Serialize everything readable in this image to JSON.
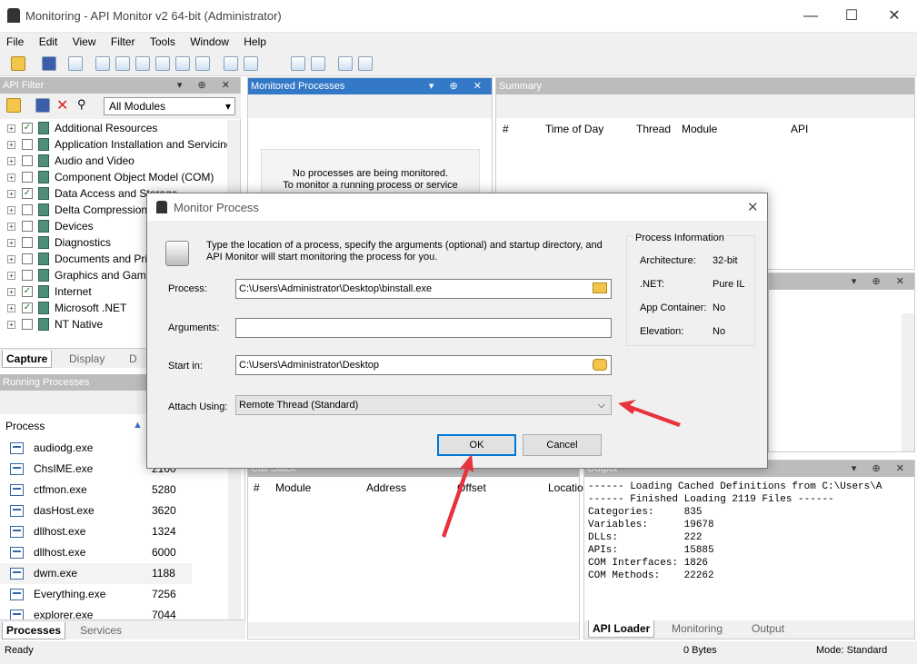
{
  "window": {
    "title": "Monitoring - API Monitor v2 64-bit (Administrator)",
    "min": "—",
    "max": "☐",
    "close": "✕"
  },
  "menu": [
    "File",
    "Edit",
    "View",
    "Filter",
    "Tools",
    "Window",
    "Help"
  ],
  "api_filter": {
    "title": "API Filter",
    "module_select": "All Modules",
    "items": [
      {
        "label": "Additional Resources",
        "checked": true
      },
      {
        "label": "Application Installation and Servicing",
        "checked": false
      },
      {
        "label": "Audio and Video",
        "checked": false
      },
      {
        "label": "Component Object Model (COM)",
        "checked": false
      },
      {
        "label": "Data Access and Storage",
        "checked": true
      },
      {
        "label": "Delta Compression",
        "checked": false
      },
      {
        "label": "Devices",
        "checked": false
      },
      {
        "label": "Diagnostics",
        "checked": false
      },
      {
        "label": "Documents and Printing",
        "checked": false
      },
      {
        "label": "Graphics and Gaming",
        "checked": false
      },
      {
        "label": "Internet",
        "checked": true
      },
      {
        "label": "Microsoft .NET",
        "checked": true
      },
      {
        "label": "NT Native",
        "checked": false
      }
    ],
    "tabs": [
      "Capture",
      "Display",
      "D"
    ]
  },
  "running_processes": {
    "title": "Running Processes",
    "col_process": "Process",
    "rows": [
      {
        "name": "audiodg.exe",
        "pid": ""
      },
      {
        "name": "ChsIME.exe",
        "pid": "2100"
      },
      {
        "name": "ctfmon.exe",
        "pid": "5280"
      },
      {
        "name": "dasHost.exe",
        "pid": "3620"
      },
      {
        "name": "dllhost.exe",
        "pid": "1324"
      },
      {
        "name": "dllhost.exe",
        "pid": "6000"
      },
      {
        "name": "dwm.exe",
        "pid": "1188"
      },
      {
        "name": "Everything.exe",
        "pid": "7256"
      },
      {
        "name": "explorer.exe",
        "pid": "7044"
      }
    ],
    "tabs": [
      "Processes",
      "Services"
    ]
  },
  "monitored": {
    "title": "Monitored Processes",
    "msg1": "No processes are being monitored.",
    "msg2": "To monitor a running process or service"
  },
  "summary": {
    "title": "Summary",
    "cols": [
      "#",
      "Time of Day",
      "Thread",
      "Module",
      "API"
    ]
  },
  "callstack": {
    "title": "Call Stack",
    "cols": [
      "#",
      "Module",
      "Address",
      "Offset",
      "Locatio"
    ]
  },
  "output": {
    "title": "Output",
    "lines": [
      "------ Loading Cached Definitions from C:\\Users\\A",
      "------ Finished Loading 2119 Files ------",
      "Categories:     835",
      "Variables:      19678",
      "DLLs:           222",
      "APIs:           15885",
      "COM Interfaces: 1826",
      "COM Methods:    22262"
    ],
    "tabs": [
      "API Loader",
      "Monitoring",
      "Output"
    ]
  },
  "dialog": {
    "title": "Monitor Process",
    "intro": "Type the location of a process, specify the arguments (optional) and startup directory, and API Monitor will start monitoring the process for you.",
    "process_label": "Process:",
    "process_value": "C:\\Users\\Administrator\\Desktop\\binstall.exe",
    "arguments_label": "Arguments:",
    "arguments_value": "",
    "startin_label": "Start in:",
    "startin_value": "C:\\Users\\Administrator\\Desktop",
    "attach_label": "Attach Using:",
    "attach_value": "Remote Thread (Standard)",
    "ok": "OK",
    "cancel": "Cancel",
    "info": {
      "title": "Process Information",
      "arch_label": "Architecture:",
      "arch_value": "32-bit",
      "net_label": ".NET:",
      "net_value": "Pure IL",
      "appc_label": "App Container:",
      "appc_value": "No",
      "elev_label": "Elevation:",
      "elev_value": "No"
    }
  },
  "status": {
    "left": "Ready",
    "bytes": "0 Bytes",
    "mode": "Mode: Standard"
  },
  "colors": {
    "accent": "#3379c7",
    "arrow": "#e8323c"
  }
}
